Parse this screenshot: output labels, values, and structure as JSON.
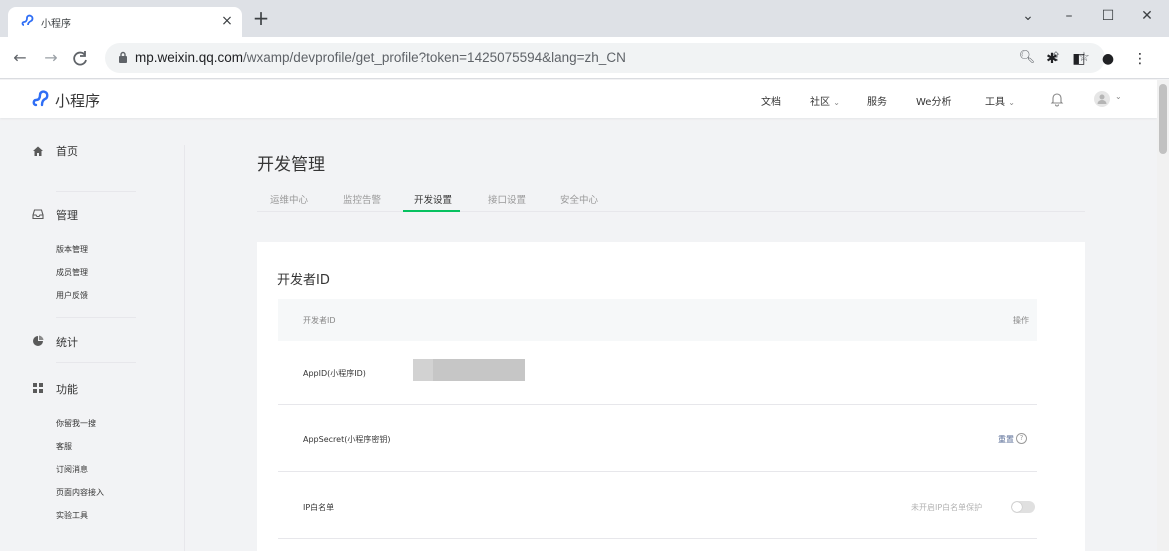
{
  "browser": {
    "tab_title": "小程序",
    "tab_close": "×",
    "new_tab": "+",
    "url_host": "mp.weixin.qq.com",
    "url_path": "/wxamp/devprofile/get_profile?token=1425075594&lang=zh_CN",
    "window_controls": [
      "⌄",
      "–",
      "☐",
      "✕"
    ]
  },
  "header": {
    "brand": "小程序",
    "nav": [
      {
        "label": "文档",
        "caret": ""
      },
      {
        "label": "社区",
        "caret": "⌄"
      },
      {
        "label": "服务",
        "caret": ""
      },
      {
        "label": "We分析",
        "caret": ""
      },
      {
        "label": "工具",
        "caret": "⌄"
      }
    ],
    "avatar_caret": "⌄"
  },
  "sidebar": {
    "home": "首页",
    "manage": "管理",
    "manage_items": [
      "版本管理",
      "成员管理",
      "用户反馈"
    ],
    "stats": "统计",
    "features": "功能",
    "feature_items": [
      "你留我一搜",
      "客服",
      "订阅消息",
      "页面内容接入",
      "实验工具"
    ]
  },
  "main": {
    "title": "开发管理",
    "tabs": [
      "运维中心",
      "监控告警",
      "开发设置",
      "接口设置",
      "安全中心"
    ],
    "active_tab": 2,
    "card": {
      "title": "开发者ID",
      "col_left": "开发者ID",
      "col_right": "操作",
      "rows": {
        "appid_label": "AppID(小程序ID)",
        "appid_value": "",
        "secret_label": "AppSecret(小程序密钥)",
        "secret_action": "重置",
        "ip_label": "IP白名单",
        "ip_status": "未开启IP白名单保护"
      }
    }
  },
  "colors": {
    "accent_green": "#07c160",
    "link_blue": "#576b95"
  }
}
